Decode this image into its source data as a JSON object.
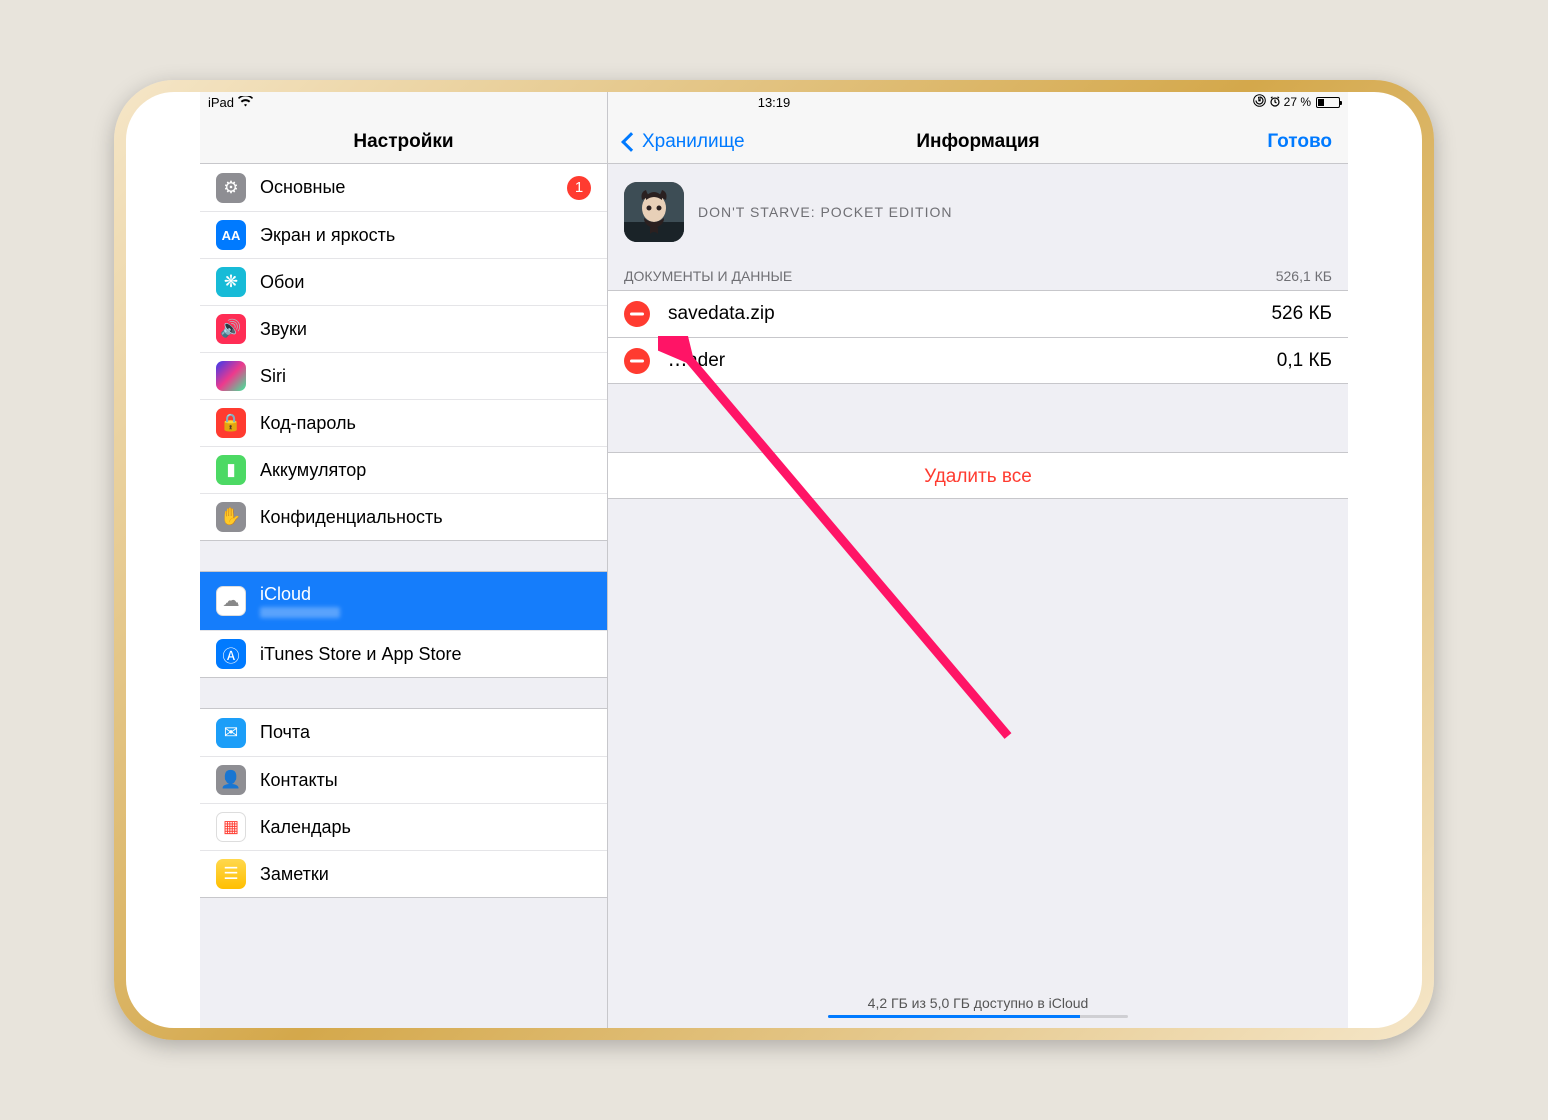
{
  "statusbar": {
    "device": "iPad",
    "time": "13:19",
    "battery_pct": "27 %"
  },
  "left": {
    "title": "Настройки",
    "groups": [
      [
        {
          "icon": "gear",
          "label": "Основные",
          "badge": "1"
        },
        {
          "icon": "aa",
          "label": "Экран и яркость"
        },
        {
          "icon": "wall",
          "label": "Обои"
        },
        {
          "icon": "snd",
          "label": "Звуки"
        },
        {
          "icon": "siri",
          "label": "Siri"
        },
        {
          "icon": "lock",
          "label": "Код-пароль"
        },
        {
          "icon": "batt",
          "label": "Аккумулятор"
        },
        {
          "icon": "priv",
          "label": "Конфиденциальность"
        }
      ],
      [
        {
          "icon": "cloud",
          "label": "iCloud",
          "selected": true,
          "sub": true
        },
        {
          "icon": "store",
          "label": "iTunes Store и App Store"
        }
      ],
      [
        {
          "icon": "mail",
          "label": "Почта"
        },
        {
          "icon": "contacts",
          "label": "Контакты"
        },
        {
          "icon": "cal",
          "label": "Календарь"
        },
        {
          "icon": "notes",
          "label": "Заметки"
        }
      ]
    ]
  },
  "right": {
    "back": "Хранилище",
    "title": "Информация",
    "done": "Готово",
    "app_name": "DON'T STARVE: POCKET EDITION",
    "section": "ДОКУМЕНТЫ И ДАННЫЕ",
    "section_size": "526,1 КБ",
    "files": [
      {
        "name": "savedata.zip",
        "size": "526 КБ"
      },
      {
        "name": "․․․ader",
        "size": "0,1 КБ"
      }
    ],
    "delete_all": "Удалить все",
    "footer": "4,2 ГБ из 5,0 ГБ доступно в iCloud"
  }
}
